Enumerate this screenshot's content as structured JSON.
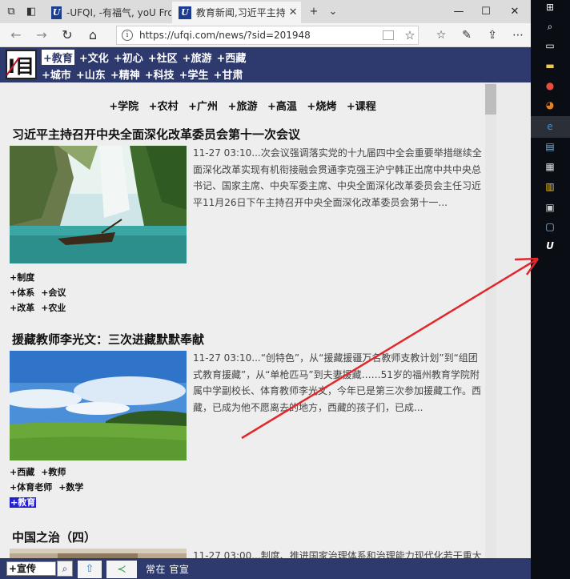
{
  "browser": {
    "tabs": [
      {
        "title": "-UFQI, -有福气, yoU Frotly C"
      },
      {
        "title": "教育新闻,习近平主持召:"
      }
    ],
    "url": "https://ufqi.com/news/?sid=201948"
  },
  "site": {
    "logo_text": "I目",
    "nav_row1": [
      {
        "label": "+教育",
        "active": true
      },
      {
        "label": "+文化"
      },
      {
        "label": "+初心"
      },
      {
        "label": "+社区"
      },
      {
        "label": "+旅游"
      },
      {
        "label": "+西藏"
      }
    ],
    "nav_row2": [
      {
        "label": "+城市"
      },
      {
        "label": "+山东"
      },
      {
        "label": "+精神"
      },
      {
        "label": "+科技"
      },
      {
        "label": "+学生"
      },
      {
        "label": "+甘肃"
      }
    ],
    "categories": [
      "+学院",
      "+农村",
      "+广州",
      "+旅游",
      "+高温",
      "+烧烤",
      "+课程"
    ]
  },
  "articles": [
    {
      "title": "习近平主持召开中央全面深化改革委员会第十一次会议",
      "summary": "11-27 03:10...次会议强调落实党的十九届四中全会重要举措继续全面深化改革实现有机衔接融会贯通李克强王沪宁韩正出席中共中央总书记、国家主席、中央军委主席、中央全面深化改革委员会主任习近平11月26日下午主持召开中央全面深化改革委员会第十一...",
      "tags": [
        [
          "+制度"
        ],
        [
          "+体系",
          "+会议"
        ],
        [
          "+改革",
          "+农业"
        ]
      ]
    },
    {
      "title": "援藏教师李光文：三次进藏默默奉献",
      "summary": "11-27 03:10...“创特色”，从“援藏援疆万名教师支教计划”到“组团式教育援藏”，从“单枪匹马”到夫妻援藏……51岁的福州教育学院附属中学副校长、体育教师李光文，今年已是第三次参加援藏工作。西藏，已成为他不愿离去的地方，西藏的孩子们，已成...",
      "tags": [
        [
          "+西藏",
          "+教师"
        ],
        [
          "+体育老师",
          "+数学"
        ]
      ],
      "highlight_tag": "+教育"
    },
    {
      "title": "中国之治（四）",
      "summary": "11-27 03:00...制度、推进国家治理体系和治理能力现代化若干重大"
    }
  ],
  "bottom_bar": {
    "search_value": "+宣传",
    "text": "常在 官宣"
  }
}
